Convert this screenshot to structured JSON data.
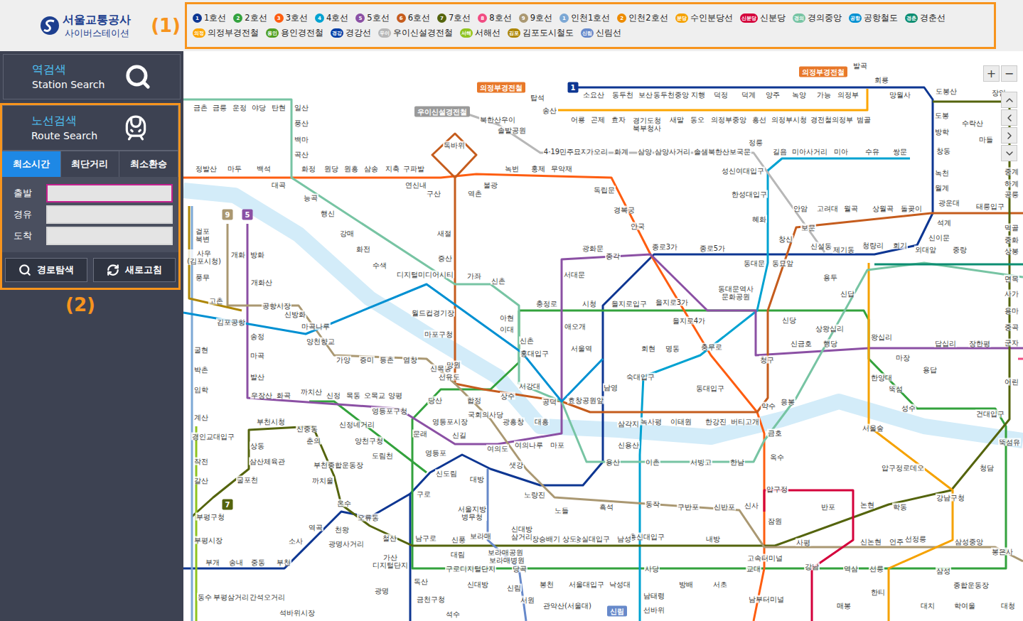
{
  "header": {
    "logo_title": "서울교통공사",
    "logo_subtitle": "사이버스테이션",
    "marker": "(1)"
  },
  "lines": [
    {
      "label": "1호선",
      "badge": "1",
      "color": "#0d3692"
    },
    {
      "label": "2호선",
      "badge": "2",
      "color": "#33a23d"
    },
    {
      "label": "3호선",
      "badge": "3",
      "color": "#fe5d10"
    },
    {
      "label": "4호선",
      "badge": "4",
      "color": "#00a2d1"
    },
    {
      "label": "5호선",
      "badge": "5",
      "color": "#8b50a4"
    },
    {
      "label": "6호선",
      "badge": "6",
      "color": "#c55c1d"
    },
    {
      "label": "7호선",
      "badge": "7",
      "color": "#54640d"
    },
    {
      "label": "8호선",
      "badge": "8",
      "color": "#f14c82"
    },
    {
      "label": "9호선",
      "badge": "9",
      "color": "#aa9872"
    },
    {
      "label": "인천1호선",
      "badge": "1",
      "color": "#7ca8d5"
    },
    {
      "label": "인천2호선",
      "badge": "2",
      "color": "#ed8b00"
    },
    {
      "label": "수인분당선",
      "badge": "분당",
      "color": "#f5a200"
    },
    {
      "label": "신분당",
      "badge": "신분당",
      "color": "#d4003b"
    },
    {
      "label": "경의중앙",
      "badge": "경의",
      "color": "#77c4a3"
    },
    {
      "label": "공항철도",
      "badge": "공항",
      "color": "#0090d2"
    },
    {
      "label": "경춘선",
      "badge": "경춘",
      "color": "#0c8e72"
    },
    {
      "label": "의정부경전철",
      "badge": "의정",
      "color": "#fda600"
    },
    {
      "label": "용인경전철",
      "badge": "용인",
      "color": "#509f22"
    },
    {
      "label": "경강선",
      "badge": "경강",
      "color": "#003da5"
    },
    {
      "label": "우이신설경전철",
      "badge": "우이",
      "color": "#b7b7b7"
    },
    {
      "label": "서해선",
      "badge": "서해",
      "color": "#8fc31f"
    },
    {
      "label": "김포도시철도",
      "badge": "김포",
      "color": "#ad8605"
    },
    {
      "label": "신림선",
      "badge": "신림",
      "color": "#6789ca"
    }
  ],
  "sidebar": {
    "station_search": {
      "title": "역검색",
      "subtitle": "Station Search"
    },
    "route_search": {
      "title": "노선검색",
      "subtitle": "Route Search"
    },
    "tabs": [
      {
        "label": "최소시간",
        "selected": true
      },
      {
        "label": "최단거리",
        "selected": false
      },
      {
        "label": "최소환승",
        "selected": false
      }
    ],
    "fields": [
      {
        "label": "출발",
        "value": "",
        "focused": true
      },
      {
        "label": "경유",
        "value": "",
        "focused": false
      },
      {
        "label": "도착",
        "value": "",
        "focused": false
      }
    ],
    "buttons": [
      "경로탐색",
      "새로고침"
    ],
    "marker": "(2)"
  },
  "map": {
    "zoom": [
      "+",
      "−"
    ],
    "badges": [
      {
        "text": "1",
        "color": "#0d3692"
      },
      {
        "text": "의정부경전철",
        "color": "#e8782a"
      },
      {
        "text": "의정부경전철",
        "color": "#e8782a"
      },
      {
        "text": "우이신설경전철",
        "color": "#9a9a9a"
      },
      {
        "text": "9",
        "color": "#aa9872"
      },
      {
        "text": "5",
        "color": "#8b50a4"
      },
      {
        "text": "7",
        "color": "#54640d"
      },
      {
        "text": "신림",
        "color": "#6789ca"
      }
    ],
    "stations": [
      "소요산",
      "동두천",
      "보산",
      "동두천중앙",
      "지행",
      "덕정",
      "덕계",
      "양주",
      "녹양",
      "가능",
      "의정부",
      "회룡",
      "발곡",
      "망월사",
      "도봉산",
      "장암",
      "탑석",
      "송산",
      "어룡",
      "곤제",
      "효자",
      "경기도청\n북부청사",
      "새말",
      "동오",
      "의정부중앙",
      "흥선",
      "의정부시청",
      "경전철의정부",
      "범골",
      "북한산우이",
      "솔밭공원",
      "4·19민주묘지",
      "가오리",
      "화계",
      "삼양",
      "삼양사거리",
      "솔샘",
      "북한산보국문",
      "정릉",
      "성신여대입구",
      "길음",
      "미아사거리",
      "미아",
      "수유",
      "쌍문",
      "도봉",
      "방학",
      "창동",
      "녹천",
      "월계",
      "광운대",
      "석계",
      "신이문",
      "외대앞",
      "수락산",
      "마들",
      "중계",
      "하계",
      "공릉",
      "태릉입구",
      "한성대입구",
      "혜화",
      "창신",
      "보문",
      "안암",
      "고려대",
      "월곡",
      "상월곡",
      "돌곶이",
      "제기동",
      "청량리",
      "회기",
      "중랑",
      "먹골",
      "중화",
      "상봉",
      "신설동",
      "동묘앞",
      "동대문",
      "종로5가",
      "종로3가",
      "종각",
      "광화문",
      "서대문",
      "용두",
      "신답",
      "면목",
      "사가",
      "용마",
      "중곡",
      "군자",
      "금촌",
      "금릉",
      "운정",
      "야당",
      "탄현",
      "일산",
      "풍산",
      "백마",
      "곡산",
      "정발산",
      "마두",
      "백석",
      "대곡",
      "화정",
      "원당",
      "원흥",
      "삼송",
      "지축",
      "구파발",
      "연신내",
      "독바위",
      "구산",
      "역촌",
      "불광",
      "녹번",
      "홍제",
      "무악재",
      "독립문",
      "경복궁",
      "안국",
      "능곡",
      "행신",
      "강매",
      "화전",
      "수색",
      "새절",
      "증산",
      "디지털미디어시티",
      "가좌",
      "신촌",
      "걸포\n북변",
      "사우\n(김포시청)",
      "풍무",
      "고촌",
      "개화",
      "방화",
      "개화산",
      "공항시장",
      "신방화",
      "마곡나루",
      "양천향교",
      "김포공항",
      "송정",
      "마곡",
      "발산",
      "우장산",
      "화곡",
      "까치산",
      "신정",
      "목동",
      "오목교",
      "양평",
      "가양",
      "증미",
      "등촌",
      "염창",
      "신목동",
      "선유도",
      "당산",
      "영등포구청",
      "신정네거리",
      "양천구청",
      "도림천",
      "문래",
      "영등포시장",
      "신길",
      "영등포",
      "국회의사당",
      "여의도",
      "여의나루",
      "마포",
      "신도림",
      "대방",
      "샛강",
      "노량진",
      "노들",
      "월드컵경기장",
      "마포구청",
      "망원",
      "합정",
      "상수",
      "광흥창",
      "대흥",
      "아현",
      "이대",
      "신촌",
      "서강대",
      "홍대입구",
      "공덕",
      "효창공원앞",
      "애오개",
      "충정로",
      "시청",
      "을지로입구",
      "을지로3가",
      "을지로4가",
      "동대문역사\n문화공원",
      "서울역",
      "회현",
      "명동",
      "충무로",
      "숙대입구",
      "남영",
      "동대입구",
      "삼각지",
      "녹사평",
      "이태원",
      "한강진",
      "버티고개",
      "약수",
      "신용산",
      "용산",
      "이촌",
      "서빙고",
      "한남",
      "금호",
      "옥수",
      "응봉",
      "신당",
      "상왕십리",
      "신금호",
      "행당",
      "청구",
      "왕십리",
      "마장",
      "답십리",
      "장한평",
      "용답",
      "한양대",
      "뚝섬",
      "성수",
      "건대입구",
      "서울숲",
      "압구정로데오",
      "청담",
      "어린",
      "뚝섬유",
      "압구정",
      "신사",
      "잠원",
      "반포",
      "논현",
      "학동",
      "강남구청",
      "흑석",
      "동작",
      "구반포",
      "신반포",
      "고속터미널",
      "사평",
      "신논현",
      "언주",
      "선정릉",
      "삼성중앙",
      "봉은사",
      "교대",
      "강남",
      "역삼",
      "선릉",
      "삼성",
      "종합운동장",
      "한티",
      "매봉",
      "대치",
      "학여울",
      "대청",
      "남부터미널",
      "서초",
      "방배",
      "사당",
      "남태령",
      "선바위",
      "총신대입구",
      "내방",
      "남성",
      "숭실대입구",
      "상도",
      "장승배기",
      "신대방\n삼거리",
      "보라매",
      "서울지방\n병무청",
      "보라매공원",
      "보라매병원",
      "당곡",
      "신풍",
      "대림",
      "구로디지털단지",
      "신대방",
      "신림",
      "봉천",
      "서울대입구",
      "낙성대",
      "서원",
      "관악산(서울대)",
      "구로",
      "남구로",
      "가산\n디지털단지",
      "철산",
      "광명사거리",
      "천왕",
      "온수",
      "오류동",
      "역곡",
      "소사",
      "부천",
      "중동",
      "송내",
      "부개",
      "까치울",
      "부천종합운동장",
      "춘의",
      "신중동",
      "부천시청",
      "상동",
      "삼산체육관",
      "굴포천",
      "부평구청",
      "부평시장",
      "독산",
      "금천구청",
      "석수",
      "광명",
      "굴현",
      "박촌",
      "임학",
      "계산",
      "경인교대입구",
      "작전",
      "갈산",
      "동수",
      "부평삼거리",
      "간석오거리",
      "석바위시장"
    ]
  }
}
